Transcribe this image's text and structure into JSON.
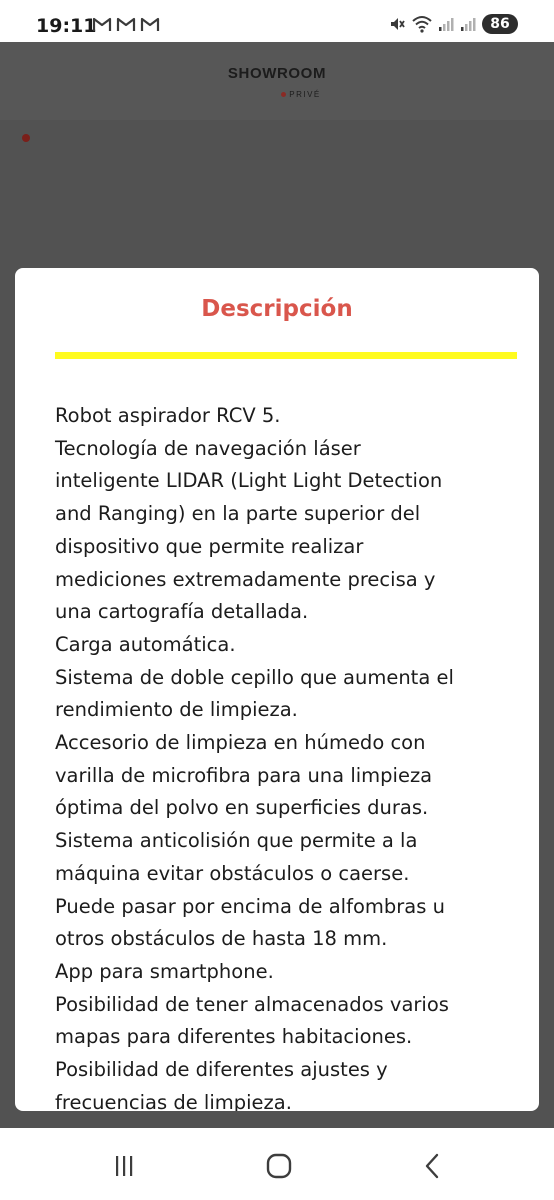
{
  "status_bar": {
    "time": "19:11",
    "notification_icons": [
      "gmail-icon",
      "gmail-icon",
      "gmail-icon"
    ],
    "battery_level": "86",
    "icons": [
      "mute-icon",
      "wifi-icon",
      "signal-icon",
      "signal-icon"
    ]
  },
  "header": {
    "brand_name": "SHOWROOM",
    "brand_sub": "PRIVÉ",
    "brand_dot_color": "#c0392b"
  },
  "modal": {
    "title": "Descripción",
    "title_color": "#d9564c",
    "underline_color": "#fffb1f",
    "lines": [
      "Robot aspirador RCV 5.",
      "Tecnología de navegación láser",
      "inteligente LIDAR (Light Light Detection",
      "and Ranging) en la parte superior del",
      "dispositivo que permite realizar",
      "mediciones extremadamente precisa y",
      "una cartografía detallada.",
      "Carga automática.",
      "Sistema de doble cepillo que aumenta el",
      "rendimiento de limpieza.",
      "Accesorio de limpieza en húmedo con",
      "varilla de microfibra para una limpieza",
      "óptima del polvo en superficies duras.",
      "Sistema anticolisión que permite a la",
      "máquina evitar obstáculos o caerse.",
      "Puede pasar por encima de alfombras u",
      "otros obstáculos de hasta 18 mm.",
      "App para smartphone.",
      "Posibilidad de tener almacenados varios",
      "mapas para diferentes habitaciones.",
      "Posibilidad de diferentes ajustes y",
      "frecuencias de limpieza."
    ]
  },
  "nav_bar": {
    "buttons": [
      "recents-icon",
      "home-icon",
      "back-icon"
    ]
  }
}
